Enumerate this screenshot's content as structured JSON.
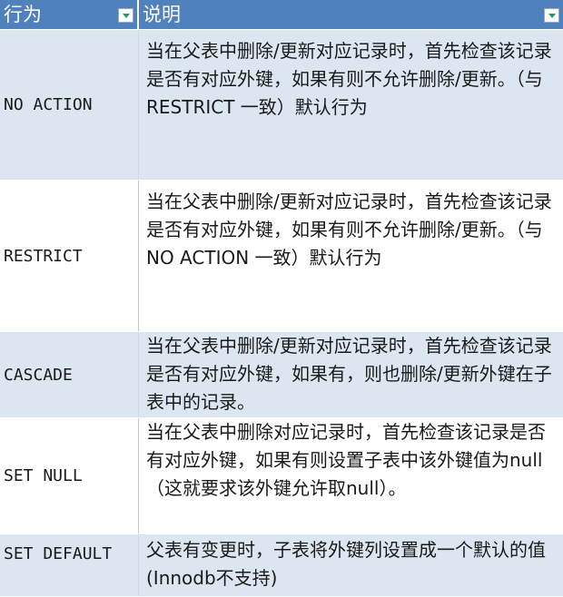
{
  "header": {
    "col1": "行为",
    "col2": "说明"
  },
  "rows": [
    {
      "action": "NO ACTION",
      "desc": "当在父表中删除/更新对应记录时，首先检查该记录是否有对应外键，如果有则不允许删除/更新。（与 RESTRICT 一致）默认行为"
    },
    {
      "action": "RESTRICT",
      "desc": "当在父表中删除/更新对应记录时，首先检查该记录是否有对应外键，如果有则不允许删除/更新。（与 NO ACTION 一致）默认行为"
    },
    {
      "action": "CASCADE",
      "desc": "当在父表中删除/更新对应记录时，首先检查该记录是否有对应外键，如果有，则也删除/更新外键在子表中的记录。"
    },
    {
      "action": "SET NULL",
      "desc": "当在父表中删除对应记录时，首先检查该记录是否有对应外键，如果有则设置子表中该外键值为null（这就要求该外键允许取null）。"
    },
    {
      "action": "SET DEFAULT",
      "desc": "父表有变更时，子表将外键列设置成一个默认的值 (Innodb不支持)"
    }
  ]
}
